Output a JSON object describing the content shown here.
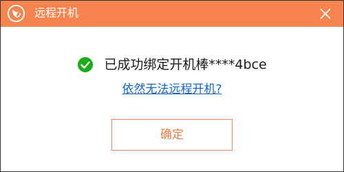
{
  "window": {
    "title": "远程开机",
    "accent_color": "#f7844f",
    "app_icon": "bird-logo-icon",
    "close_icon": "close-icon"
  },
  "message": {
    "status_icon": "check-circle-icon",
    "status_color": "#1aad19",
    "text": "已成功绑定开机棒****4bce"
  },
  "help_link": {
    "text": "依然无法远程开机?"
  },
  "confirm_button": {
    "label": "确定"
  }
}
